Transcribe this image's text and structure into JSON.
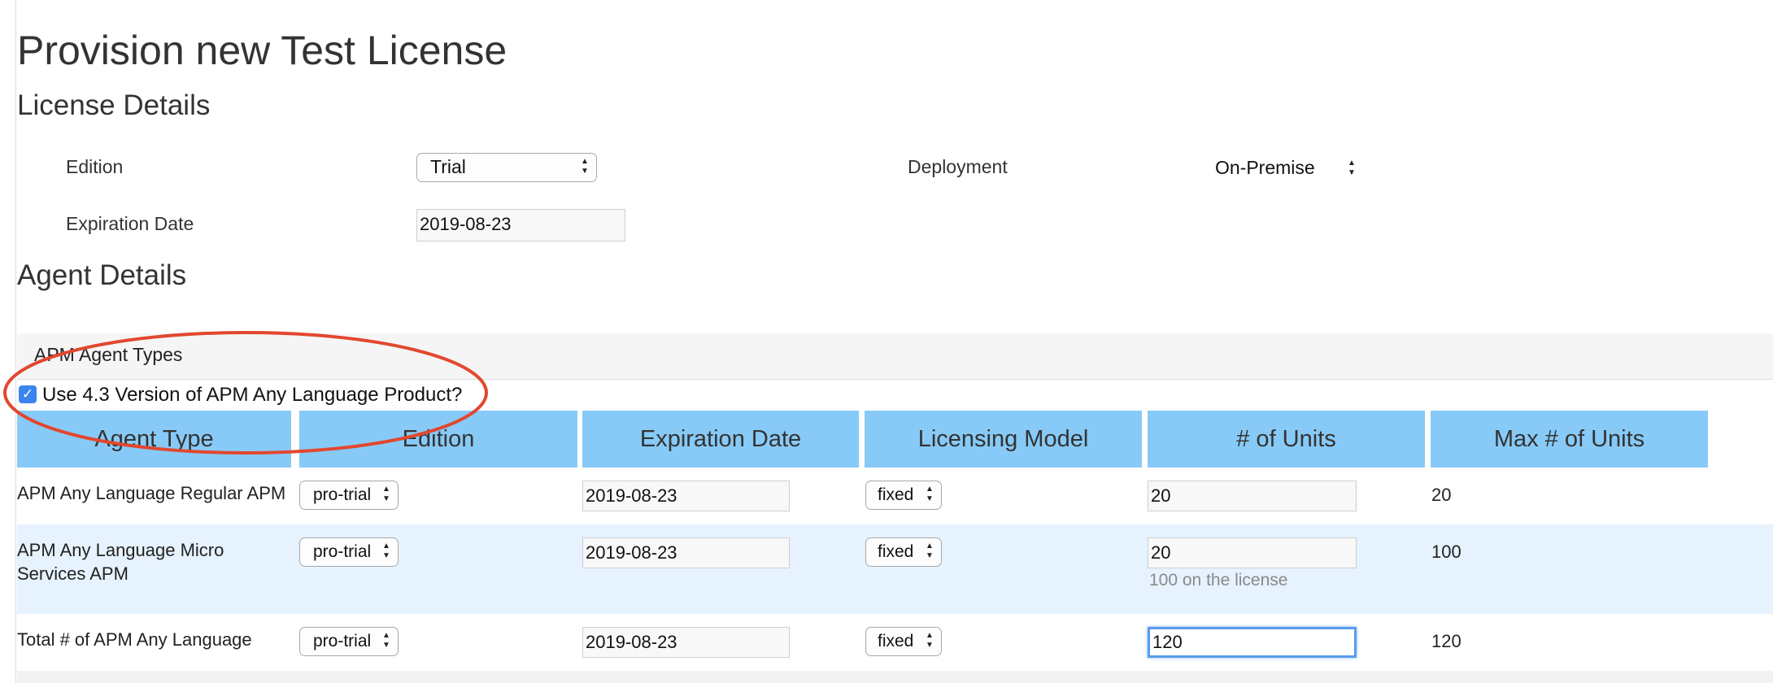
{
  "page": {
    "title": "Provision new Test License"
  },
  "license_details": {
    "heading": "License Details",
    "edition_label": "Edition",
    "edition_value": "Trial",
    "deployment_label": "Deployment",
    "deployment_value": "On-Premise",
    "expiration_label": "Expiration Date",
    "expiration_value": "2019-08-23"
  },
  "agent_details": {
    "heading": "Agent Details",
    "panel_title": "APM Agent Types",
    "checkbox_label": "Use 4.3 Version of APM Any Language Product?",
    "checkbox_checked": true
  },
  "table": {
    "headers": [
      "Agent Type",
      "Edition",
      "Expiration Date",
      "Licensing Model",
      "# of Units",
      "Max # of Units"
    ],
    "rows": [
      {
        "agent_type_line1": "APM Any Language Regular APM",
        "agent_type_line2": "",
        "edition": "pro-trial",
        "expiration": "2019-08-23",
        "licensing_model": "fixed",
        "units": "20",
        "units_hint": "",
        "max_units": "20"
      },
      {
        "agent_type_line1": "APM Any Language Micro",
        "agent_type_line2": "Services APM",
        "edition": "pro-trial",
        "expiration": "2019-08-23",
        "licensing_model": "fixed",
        "units": "20",
        "units_hint": "100 on the license",
        "max_units": "100"
      },
      {
        "agent_type_line1": "Total # of APM Any Language",
        "agent_type_line2": "",
        "edition": "pro-trial",
        "expiration": "2019-08-23",
        "licensing_model": "fixed",
        "units": "120",
        "units_hint": "",
        "max_units": "120"
      }
    ]
  },
  "icons": {
    "select_arrows": "▲▼",
    "checkmark": "✓"
  },
  "colors": {
    "header_bg": "#87caf7",
    "stripe_bg": "#e6f2fd",
    "annotation": "#e2472f",
    "checkbox": "#3b84f0",
    "focus": "#5b9bea"
  }
}
